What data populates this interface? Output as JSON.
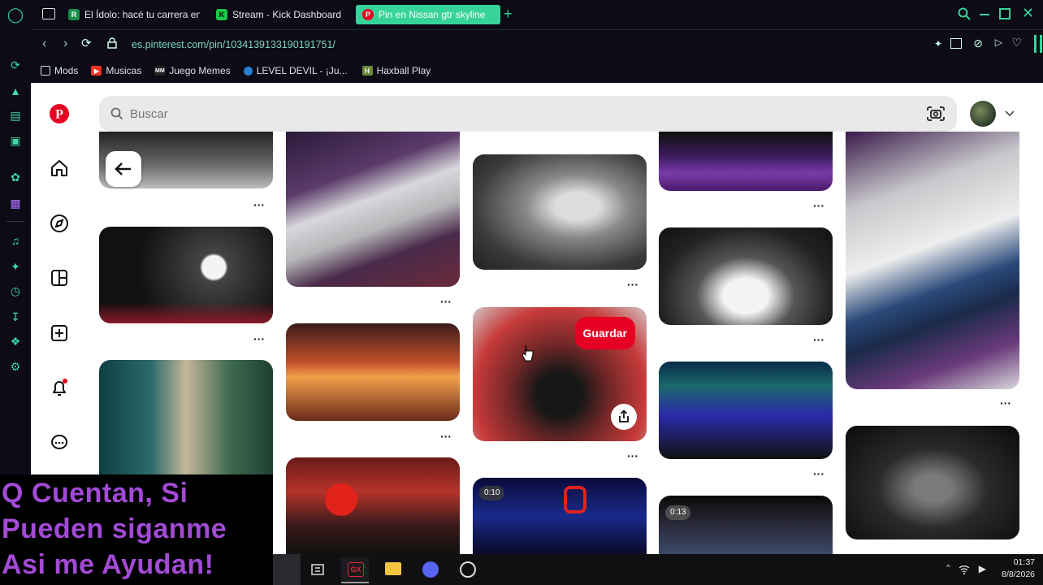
{
  "browser": {
    "tabs": [
      {
        "title": "El Ídolo: hacé tu carrera en",
        "favicon": "icon-green-r"
      },
      {
        "title": "Stream - Kick Dashboard",
        "favicon": "kick-icon"
      },
      {
        "title": "Pin en Nissan gtr skyline",
        "favicon": "pinterest-icon",
        "active": true
      }
    ],
    "new_tab": "+",
    "url": "es.pinterest.com/pin/1034139133190191751/",
    "bookmarks": [
      {
        "label": "Mods",
        "icon": "mods-icon"
      },
      {
        "label": "Musicas",
        "icon": "youtube-icon"
      },
      {
        "label": "Juego Memes",
        "icon": "mm-icon"
      },
      {
        "label": "LEVEL DEVIL - ¡Ju...",
        "icon": "globe-icon"
      },
      {
        "label": "Haxball Play",
        "icon": "haxball-icon"
      }
    ],
    "accent": "#36d39a"
  },
  "pinterest": {
    "search_placeholder": "Buscar",
    "save_label": "Guardar",
    "video_badges": [
      "0:10",
      "0:13"
    ],
    "brand_color": "#e60023"
  },
  "overlay": {
    "lines": [
      "Q Cuentan, Si",
      "Pueden siganme",
      "Asi me Ayudan!"
    ],
    "color": "#a24ad6"
  },
  "taskbar": {
    "time": "01:37",
    "date": "8/8/2026"
  }
}
